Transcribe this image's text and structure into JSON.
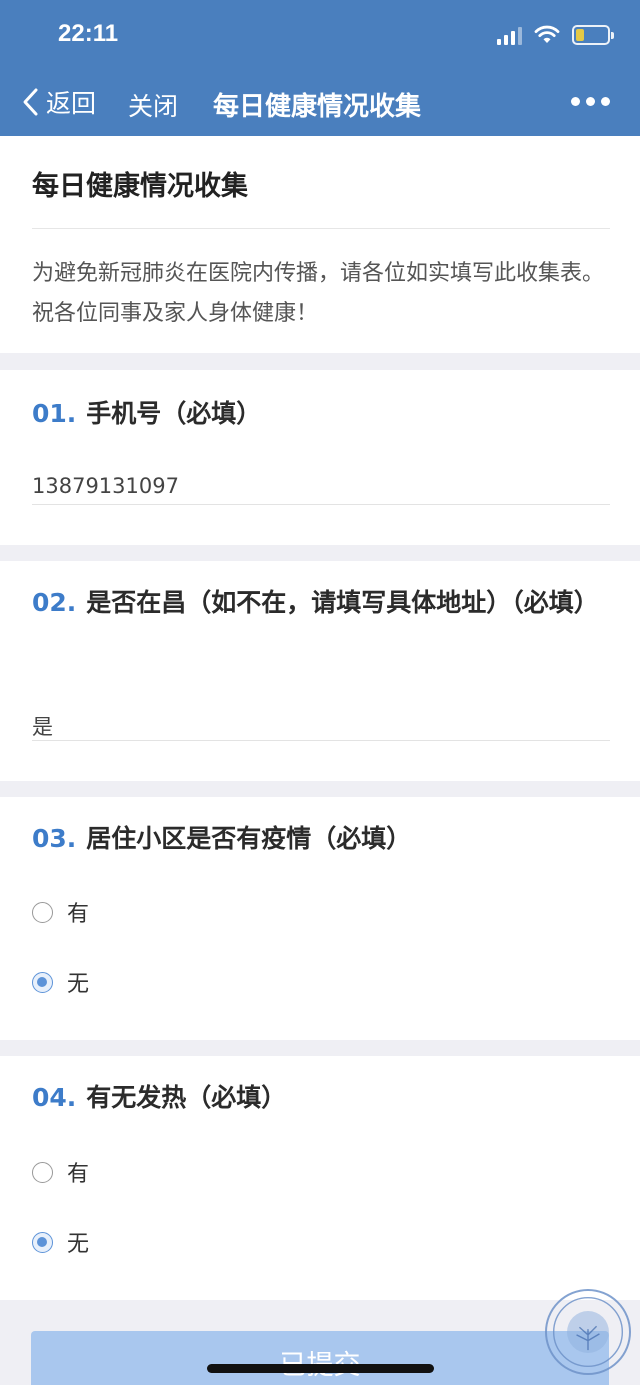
{
  "status_bar": {
    "time": "22:11",
    "icons": [
      "signal-icon",
      "wifi-icon",
      "battery-icon"
    ]
  },
  "nav": {
    "back_label": "返回",
    "close_label": "关闭",
    "title": "每日健康情况收集",
    "more_icon": "more-icon"
  },
  "intro": {
    "title": "每日健康情况收集",
    "description": "为避免新冠肺炎在医院内传播，请各位如实填写此收集表。祝各位同事及家人身体健康！"
  },
  "questions": [
    {
      "number": "01.",
      "title": "手机号（必填）",
      "answer": "13879131097"
    },
    {
      "number": "02.",
      "title": "是否在昌（如不在，请填写具体地址）（必填）",
      "answer": "是"
    },
    {
      "number": "03.",
      "title": "居住小区是否有疫情（必填）",
      "options": [
        {
          "label": "有",
          "selected": false
        },
        {
          "label": "无",
          "selected": true
        }
      ]
    },
    {
      "number": "04.",
      "title": "有无发热（必填）",
      "options": [
        {
          "label": "有",
          "selected": false
        },
        {
          "label": "无",
          "selected": true
        }
      ]
    }
  ],
  "submit": {
    "label": "已提交"
  },
  "colors": {
    "header_bg": "#4a7fbe",
    "accent": "#3d7cc9",
    "submit_bg": "#a9c7ee"
  }
}
